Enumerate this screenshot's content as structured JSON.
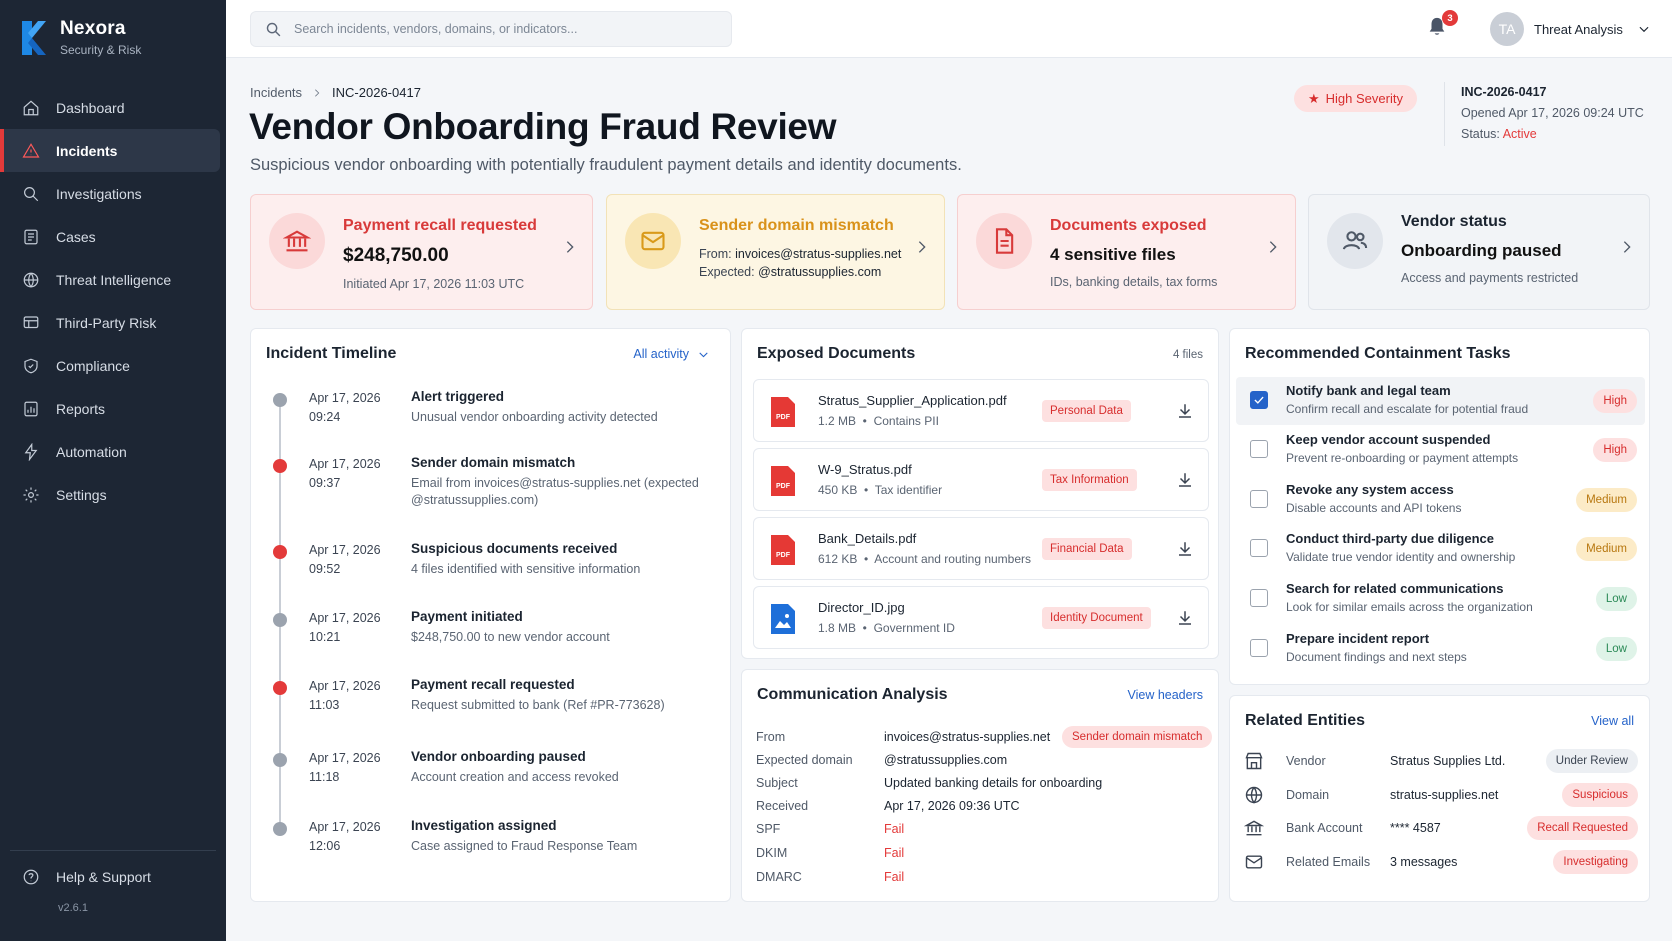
{
  "app": {
    "name": "Nexora",
    "subtitle": "Security & Risk",
    "version": "v2.6.1"
  },
  "sidebar": {
    "items": [
      {
        "label": "Dashboard",
        "icon": "home-icon"
      },
      {
        "label": "Incidents",
        "icon": "alert-triangle-icon",
        "active": true
      },
      {
        "label": "Investigations",
        "icon": "search-icon"
      },
      {
        "label": "Cases",
        "icon": "folder-icon"
      },
      {
        "label": "Threat Intelligence",
        "icon": "globe-icon"
      },
      {
        "label": "Third-Party Risk",
        "icon": "network-icon"
      },
      {
        "label": "Compliance",
        "icon": "shield-icon"
      },
      {
        "label": "Reports",
        "icon": "chart-icon"
      },
      {
        "label": "Automation",
        "icon": "bolt-icon"
      },
      {
        "label": "Settings",
        "icon": "gear-icon"
      }
    ],
    "help": "Help & Support"
  },
  "topbar": {
    "search_placeholder": "Search incidents, vendors, domains, or indicators...",
    "notifications_count": "3",
    "user_initials": "TA",
    "user_name": "Threat Analysis"
  },
  "header": {
    "breadcrumb_root": "Incidents",
    "breadcrumb_current": "INC-2026-0417",
    "title": "Vendor Onboarding Fraud Review",
    "subtitle": "Suspicious vendor onboarding with potentially fraudulent payment details and identity documents.",
    "severity": "High Severity",
    "incident_id": "INC-2026-0417",
    "opened": "Opened Apr 17, 2026  09:24 UTC",
    "status_label": "Status:",
    "status_value": "Active"
  },
  "summary": {
    "recall": {
      "title": "Payment recall requested",
      "amount": "$248,750.00",
      "meta": "Initiated Apr 17, 2026  11:03 UTC"
    },
    "sender": {
      "title": "Sender domain mismatch",
      "from_label": "From:",
      "from_value": "invoices@stratus-supplies.net",
      "expected_label": "Expected:",
      "expected_value": "@stratussupplies.com"
    },
    "documents": {
      "title": "Documents exposed",
      "count": "4 sensitive files",
      "meta": "IDs, banking details, tax forms"
    },
    "vendor": {
      "title": "Vendor status",
      "status": "Onboarding paused",
      "meta": "Access and payments restricted"
    }
  },
  "timeline": {
    "title": "Incident Timeline",
    "filter": "All activity",
    "items": [
      {
        "date": "Apr 17, 2026",
        "time": "09:24",
        "title": "Alert triggered",
        "desc": "Unusual vendor onboarding activity detected",
        "critical": false
      },
      {
        "date": "Apr 17, 2026",
        "time": "09:37",
        "title": "Sender domain mismatch",
        "desc": "Email from invoices@stratus-supplies.net (expected @stratussupplies.com)",
        "critical": true
      },
      {
        "date": "Apr 17, 2026",
        "time": "09:52",
        "title": "Suspicious documents received",
        "desc": "4 files identified with sensitive information",
        "critical": true
      },
      {
        "date": "Apr 17, 2026",
        "time": "10:21",
        "title": "Payment initiated",
        "desc": "$248,750.00 to new vendor account",
        "critical": false
      },
      {
        "date": "Apr 17, 2026",
        "time": "11:03",
        "title": "Payment recall requested",
        "desc": "Request submitted to bank (Ref #PR-773628)",
        "critical": true
      },
      {
        "date": "Apr 17, 2026",
        "time": "11:18",
        "title": "Vendor onboarding paused",
        "desc": "Account creation and access revoked",
        "critical": false
      },
      {
        "date": "Apr 17, 2026",
        "time": "12:06",
        "title": "Investigation assigned",
        "desc": "Case assigned to Fraud Response Team",
        "critical": false
      }
    ]
  },
  "documents": {
    "title": "Exposed Documents",
    "count": "4 files",
    "items": [
      {
        "name": "Stratus_Supplier_Application.pdf",
        "size": "1.2 MB",
        "detail": "Contains PII",
        "tag": "Personal Data",
        "kind": "pdf"
      },
      {
        "name": "W-9_Stratus.pdf",
        "size": "450 KB",
        "detail": "Tax identifier",
        "tag": "Tax Information",
        "kind": "pdf"
      },
      {
        "name": "Bank_Details.pdf",
        "size": "612 KB",
        "detail": "Account and routing numbers",
        "tag": "Financial Data",
        "kind": "pdf"
      },
      {
        "name": "Director_ID.jpg",
        "size": "1.8 MB",
        "detail": "Government ID",
        "tag": "Identity Document",
        "kind": "image"
      }
    ]
  },
  "communication": {
    "title": "Communication Analysis",
    "link": "View headers",
    "rows": [
      {
        "label": "From",
        "value": "invoices@stratus-supplies.net",
        "tag": "Sender domain mismatch"
      },
      {
        "label": "Expected domain",
        "value": "@stratussupplies.com"
      },
      {
        "label": "Subject",
        "value": "Updated banking details for onboarding"
      },
      {
        "label": "Received",
        "value": "Apr 17, 2026  09:36 UTC"
      },
      {
        "label": "SPF",
        "value": "Fail",
        "fail": true
      },
      {
        "label": "DKIM",
        "value": "Fail",
        "fail": true
      },
      {
        "label": "DMARC",
        "value": "Fail",
        "fail": true
      }
    ]
  },
  "tasks": {
    "title": "Recommended Containment Tasks",
    "items": [
      {
        "title": "Notify bank and legal team",
        "desc": "Confirm recall and escalate for potential fraud",
        "priority": "High",
        "level": "high",
        "done": true
      },
      {
        "title": "Keep vendor account suspended",
        "desc": "Prevent re-onboarding or payment attempts",
        "priority": "High",
        "level": "high",
        "done": false
      },
      {
        "title": "Revoke any system access",
        "desc": "Disable accounts and API tokens",
        "priority": "Medium",
        "level": "med",
        "done": false
      },
      {
        "title": "Conduct third-party due diligence",
        "desc": "Validate true vendor identity and ownership",
        "priority": "Medium",
        "level": "med",
        "done": false
      },
      {
        "title": "Search for related communications",
        "desc": "Look for similar emails across the organization",
        "priority": "Low",
        "level": "low",
        "done": false
      },
      {
        "title": "Prepare incident report",
        "desc": "Document findings and next steps",
        "priority": "Low",
        "level": "low",
        "done": false
      }
    ]
  },
  "entities": {
    "title": "Related Entities",
    "link": "View all",
    "items": [
      {
        "type": "Vendor",
        "value": "Stratus Supplies Ltd.",
        "tag": "Under Review",
        "style": "gray",
        "icon": "storefront-icon"
      },
      {
        "type": "Domain",
        "value": "stratus-supplies.net",
        "tag": "Suspicious",
        "style": "red",
        "icon": "globe-icon"
      },
      {
        "type": "Bank Account",
        "value": "**** 4587",
        "tag": "Recall Requested",
        "style": "red",
        "icon": "bank-icon"
      },
      {
        "type": "Related Emails",
        "value": "3 messages",
        "tag": "Investigating",
        "style": "red",
        "icon": "mail-icon"
      }
    ]
  },
  "colors": {
    "accent": "#2563c9",
    "danger": "#e33a3a",
    "sidebar": "#1d2634",
    "warning": "#d9921a"
  }
}
